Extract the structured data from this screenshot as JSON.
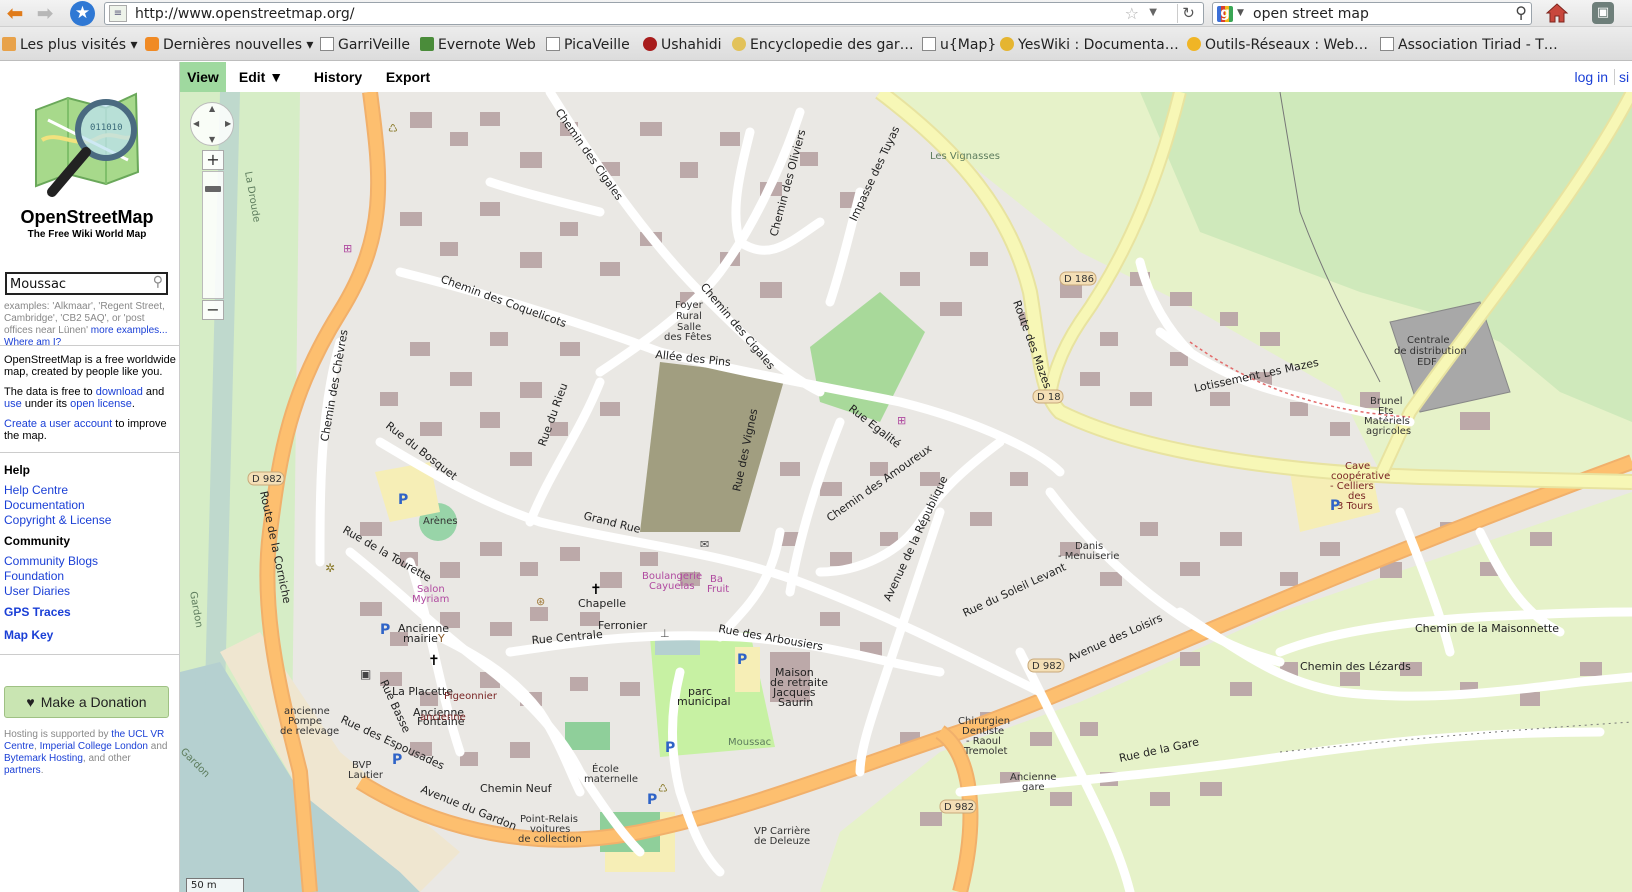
{
  "browser": {
    "url": "http://www.openstreetmap.org/",
    "search_query": "open street map",
    "search_engine_icon": "g-icon"
  },
  "bookmarks": [
    {
      "label": "Les plus visités ▾",
      "icon": "visited-icon"
    },
    {
      "label": "Dernières nouvelles ▾",
      "icon": "rss-icon"
    },
    {
      "label": "GarriVeille",
      "icon": "page-icon"
    },
    {
      "label": "Evernote Web",
      "icon": "evernote-icon"
    },
    {
      "label": "PicaVeille",
      "icon": "page-icon"
    },
    {
      "label": "Ushahidi",
      "icon": "ushahidi-icon"
    },
    {
      "label": "Encyclopedie des gar…",
      "icon": "encyclo-icon"
    },
    {
      "label": "u{Map}",
      "icon": "page-icon"
    },
    {
      "label": "YesWiki : Documenta…",
      "icon": "yeswiki-icon"
    },
    {
      "label": "Outils-Réseaux : Web…",
      "icon": "outils-icon"
    },
    {
      "label": "Association Tiriad - T…",
      "icon": "page-icon"
    }
  ],
  "sidebar": {
    "title": "OpenStreetMap",
    "tagline": "The Free Wiki World Map",
    "search_value": "Moussac",
    "examples_text": "examples: 'Alkmaar', 'Regent Street, Cambridge', 'CB2 5AQ', or 'post offices near Lünen'",
    "more_examples": "more examples...",
    "where_am_i": "Where am I?",
    "intro_1": "OpenStreetMap is a free worldwide map, created by people like you.",
    "intro_2_a": "The data is free to",
    "intro_2_download": "download",
    "intro_2_and": "and",
    "intro_2_use": "use",
    "intro_2_b": "under its",
    "intro_2_license": "open license",
    "intro_2_c": ".",
    "intro_3_link": "Create a user account",
    "intro_3_rest": "to improve the map.",
    "help_heading": "Help",
    "help_links": [
      "Help Centre",
      "Documentation",
      "Copyright & License"
    ],
    "community_heading": "Community",
    "community_links": [
      "Community Blogs",
      "Foundation",
      "User Diaries"
    ],
    "gps_traces": "GPS Traces",
    "map_key": "Map Key",
    "donate_label": "Make a Donation",
    "hosting_a": "Hosting is supported by",
    "hosting_ucl": "the UCL VR Centre",
    "hosting_comma": ",",
    "hosting_imperial": "Imperial College London",
    "hosting_and": "and",
    "hosting_bytemark": "Bytemark Hosting",
    "hosting_other": ", and other",
    "hosting_partners": "partners",
    "hosting_end": "."
  },
  "tabs": {
    "view": "View",
    "edit": "Edit ▼",
    "history": "History",
    "export": "Export",
    "login": "log in",
    "signup": "si"
  },
  "map": {
    "scale": "50 m",
    "colors": {
      "background": "#eae8e4",
      "building": "#bca9a9",
      "road": "#ffffff",
      "secondary_road": "#fdbf6f",
      "tertiary_road": "#f7f7b6",
      "farmland": "#e6f2c9",
      "vineyard": "#b3e2a8",
      "park": "#c7f1a3",
      "water": "#b5d0d0",
      "car_park": "#f6eeb6",
      "amenity_label": "#b04aa0"
    },
    "labels": {
      "chemin_des_cigales_1": "Chemin des Cigales",
      "chemin_des_cigales_2": "Chemin des Cigales",
      "chemin_des_oliviers": "Chemin des Oliviers",
      "impasse_des_tuyas": "Impasse des Tuyas",
      "les_vignasses": "Les Vignasses",
      "chemin_des_coquelicots": "Chemin des Coquelicots",
      "foyer_1": "Foyer",
      "foyer_2": "Rural",
      "foyer_3": "Salle",
      "foyer_4": "des Fêtes",
      "allee_des_pins": "Allée des Pins",
      "route_des_mazes": "Route des Mazes",
      "d186": "D 186",
      "d18": "D 18",
      "lotissement": "Lotissement Les Mazes",
      "centrale_1": "Centrale",
      "centrale_2": "de distribution",
      "centrale_3": "EDF",
      "brunel_1": "Brunel",
      "brunel_2": "Ets",
      "brunel_3": "Matériels",
      "brunel_4": "agricoles",
      "cave_1": "Cave",
      "cave_2": "coopérative",
      "cave_3": "- Celliers",
      "cave_4": "des",
      "cave_5": "3 Tours",
      "chemin_des_chevres": "Chemin des Chèvres",
      "rue_du_bosquet": "Rue du Bosquet",
      "rue_du_rieu": "Rue du Rieu",
      "rue_egalite": "Rue Egalité",
      "rue_des_vignes": "Rue des Vignes",
      "chemin_des_amoureux": "Chemin des Amoureux",
      "avenue_republique": "Avenue de la République",
      "d982_1": "D 982",
      "route_de_la_corniche": "Route de la Corniche",
      "arenes": "Arènes",
      "grand_rue": "Grand Rue",
      "rue_de_la_tourette": "Rue de la Tourette",
      "salon_1": "Salon",
      "salon_2": "Myriam",
      "boulangerie_1": "Boulangerie",
      "boulangerie_2": "Cayuelas",
      "bar_1": "Ba",
      "bar_2": "Fruit",
      "danis_1": "Danis",
      "danis_2": "- Menuiserie",
      "chapelle": "Chapelle",
      "rue_du_soleil_levant": "Rue du Soleil Levant",
      "avenue_des_loisirs": "Avenue des Loisirs",
      "chemin_maisonnette": "Chemin de la Maisonnette",
      "ancienne_mairie_1": "Ancienne",
      "ancienne_mairie_2": "mairie",
      "ferronier": "Ferronier",
      "rue_centrale": "Rue Centrale",
      "rue_des_arbousiers": "Rue des Arbousiers",
      "d982_2": "D 982",
      "chemin_des_lezards": "Chemin des Lézards",
      "ancienne_fontaine_1": "Ancienne",
      "ancienne_fontaine_2": "Fontaine",
      "la_placette": "La Placette",
      "pigeonnier": "Pigeonnier",
      "rue_basse": "Rue Basse",
      "parc_1": "parc",
      "parc_2": "municipal",
      "maison_1": "Maison",
      "maison_2": "de retraite",
      "maison_3": "Jacques",
      "maison_4": "Saurin",
      "ancienne_pompe_1": "ancienne",
      "ancienne_pompe_2": "Pompe",
      "ancienne_pompe_3": "de relevage",
      "ancienne_cim_1": "ancienne",
      "ancienne_cim_2": "cimetière",
      "rue_des_espousades": "Rue des Espousades",
      "chirurgien_1": "Chirurgien",
      "chirurgien_2": "Dentiste",
      "chirurgien_3": "- Raoul",
      "chirurgien_4": "Tremolet",
      "rue_de_la_gare": "Rue de la Gare",
      "moussac": "Moussac",
      "bvp_1": "BVP",
      "bvp_2": "Lautier",
      "ecole_1": "École",
      "ecole_2": "maternelle",
      "chemin_neuf": "Chemin Neuf",
      "ancienne_gare_1": "Ancienne",
      "ancienne_gare_2": "gare",
      "avenue_du_gardon": "Avenue du Gardon",
      "point_relais_1": "Point-Relais",
      "point_relais_2": "voitures",
      "point_relais_3": "de collection",
      "vp_carriere_1": "VP Carrière",
      "vp_carriere_2": "de Deleuze",
      "d982_3": "D 982",
      "la_droude": "La Droude",
      "gardon_1": "Gardon",
      "gardon_2": "Gardon",
      "parking": "P"
    }
  }
}
